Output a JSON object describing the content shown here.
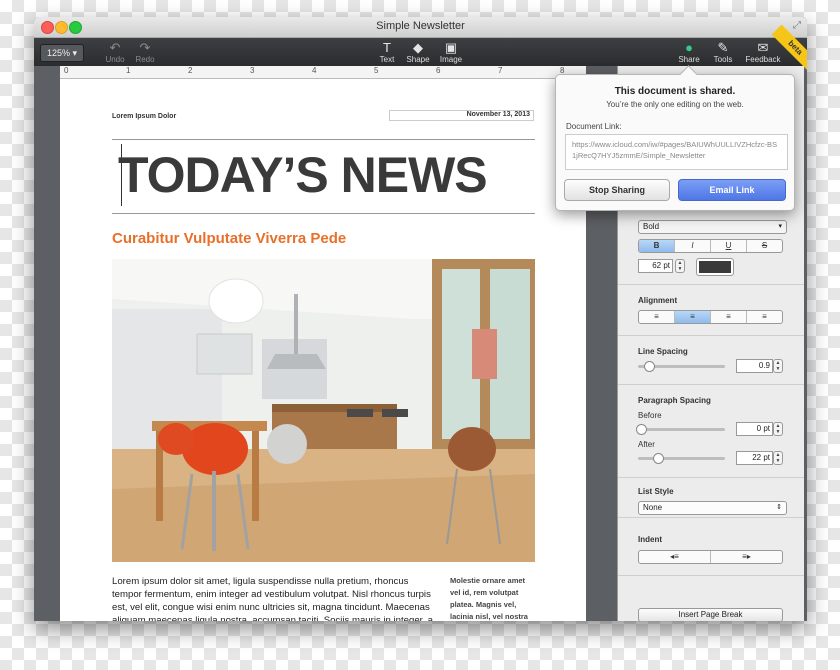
{
  "window": {
    "title": "Simple Newsletter"
  },
  "toolbar": {
    "zoom": "125% ▾",
    "undo": "Undo",
    "redo": "Redo",
    "text": "Text",
    "shape": "Shape",
    "image": "Image",
    "share": "Share",
    "tools": "Tools",
    "feedback": "Feedback",
    "beta": "beta"
  },
  "ruler": {
    "ticks": [
      "0",
      "1",
      "2",
      "3",
      "4",
      "5",
      "6",
      "7",
      "8"
    ]
  },
  "document": {
    "dateline_left": "Lorem Ipsum Dolor",
    "dateline_right": "November 13, 2013",
    "headline": "TODAY’S NEWS",
    "subhead": "Curabitur Vulputate Viverra Pede",
    "body": "Lorem ipsum dolor sit amet, ligula suspendisse nulla pretium, rhoncus tempor fermentum, enim integer ad vestibulum volutpat. Nisl rhoncus turpis est, vel elit, congue wisi enim nunc ultricies sit, magna tincidunt. Maecenas aliquam maecenas ligula nostra, accumsan taciti. Sociis mauris in integer, a",
    "sidebar": "Molestie ornare amet vel id, rem volutpat platea. Magnis vel, lacinia nisl, vel nostra"
  },
  "popover": {
    "title": "This document is shared.",
    "subtitle": "You’re the only one editing on the web.",
    "link_label": "Document Link:",
    "link": "https://www.icloud.com/iw/#pages/BAIUWhUULLIVZHcfzc-BS1jRecQ7HYJ5zmmE/Simple_Newsletter",
    "stop_button": "Stop Sharing",
    "email_button": "Email Link"
  },
  "inspector": {
    "font_style": "Bold",
    "style_buttons": [
      "B",
      "I",
      "U",
      "S"
    ],
    "font_size": "62 pt",
    "text_color": "#3a3a3a",
    "alignment": {
      "title": "Alignment",
      "options": [
        "≡",
        "≡",
        "≡",
        "≡"
      ]
    },
    "line_spacing": {
      "title": "Line Spacing",
      "value": "0.9"
    },
    "paragraph_spacing": {
      "title": "Paragraph Spacing",
      "before_label": "Before",
      "before_value": "0 pt",
      "after_label": "After",
      "after_value": "22 pt"
    },
    "list_style": {
      "title": "List Style",
      "value": "None"
    },
    "indent": {
      "title": "Indent",
      "decrease": "◂≡",
      "increase": "≡▸"
    },
    "page_break": "Insert Page Break"
  },
  "colors": {
    "accent": "#e8702a",
    "share_icon": "#35c98a",
    "email_button": "#5a7fe8"
  }
}
